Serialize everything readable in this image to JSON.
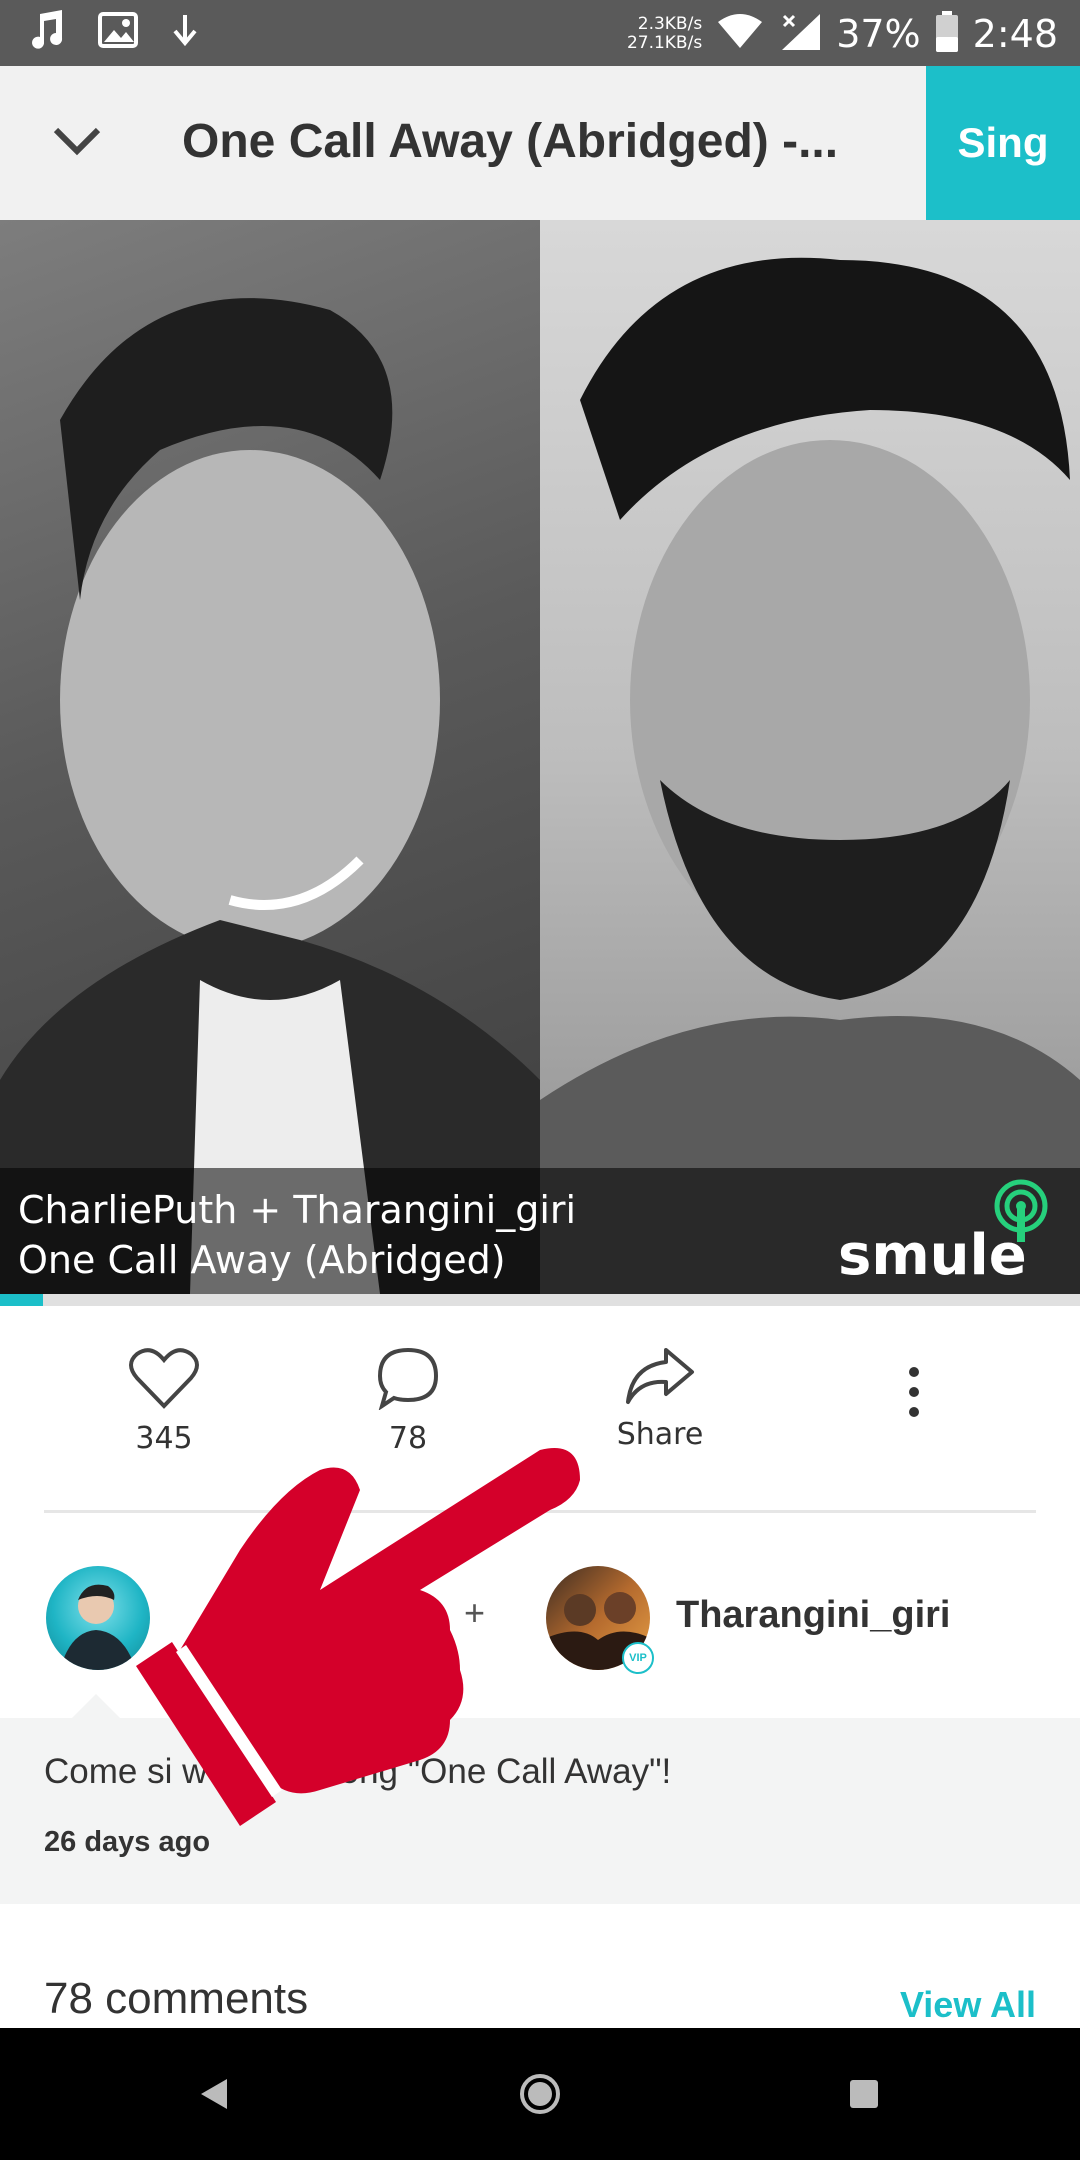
{
  "status_bar": {
    "speed_up": "2.3KB/s",
    "speed_down": "27.1KB/s",
    "battery": "37%",
    "time": "2:48"
  },
  "header": {
    "title": "One Call Away (Abridged) -...",
    "sing_label": "Sing"
  },
  "video": {
    "caption_line1": "CharliePuth + Tharangini_giri",
    "caption_line2": "One Call Away (Abridged)",
    "logo_text": "smule",
    "progress_fraction": 0.04
  },
  "actions": {
    "likes": "345",
    "comments": "78",
    "share_label": "Share"
  },
  "performers": {
    "plus": "+",
    "user2": "Tharangini_giri",
    "vip": "VIP"
  },
  "description": {
    "text": "Come si w on my song \"One Call Away\"!",
    "time": "26 days ago"
  },
  "comments": {
    "title": "78 comments",
    "view_all": "View All"
  },
  "colors": {
    "accent": "#1cbfc9",
    "hand": "#d4002a"
  }
}
